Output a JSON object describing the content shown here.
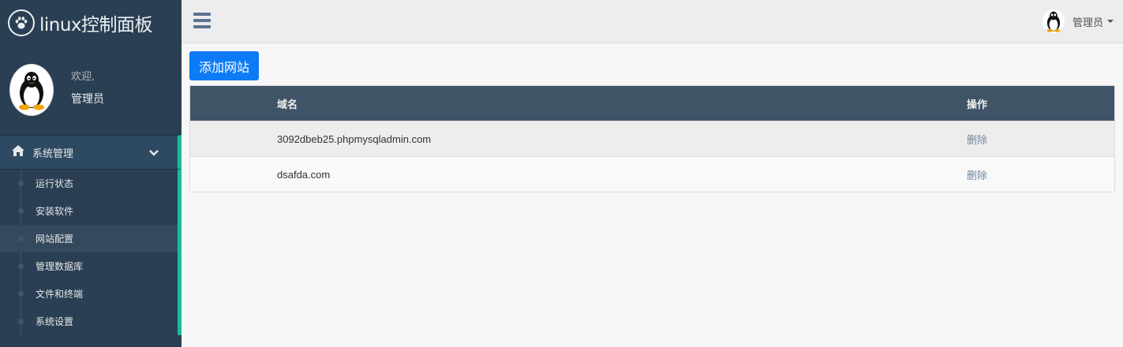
{
  "app": {
    "title": "linux控制面板"
  },
  "profile": {
    "welcome": "欢迎,",
    "name": "管理员"
  },
  "sidebar": {
    "section_label": "系统管理",
    "items": [
      {
        "label": "运行状态",
        "active": false
      },
      {
        "label": "安装软件",
        "active": false
      },
      {
        "label": "网站配置",
        "active": true
      },
      {
        "label": "管理数据库",
        "active": false
      },
      {
        "label": "文件和终端",
        "active": false
      },
      {
        "label": "系统设置",
        "active": false
      }
    ]
  },
  "topbar": {
    "user_name": "管理员"
  },
  "main": {
    "add_button": "添加网站",
    "table": {
      "headers": [
        "域名",
        "操作"
      ],
      "rows": [
        {
          "domain": "3092dbeb25.phpmysqladmin.com",
          "action": "删除"
        },
        {
          "domain": "dsafda.com",
          "action": "删除"
        }
      ]
    }
  },
  "colors": {
    "sidebar_bg": "#2a3f54",
    "accent": "#1abb9c",
    "button": "#0d7bf5",
    "table_header": "#405467"
  }
}
